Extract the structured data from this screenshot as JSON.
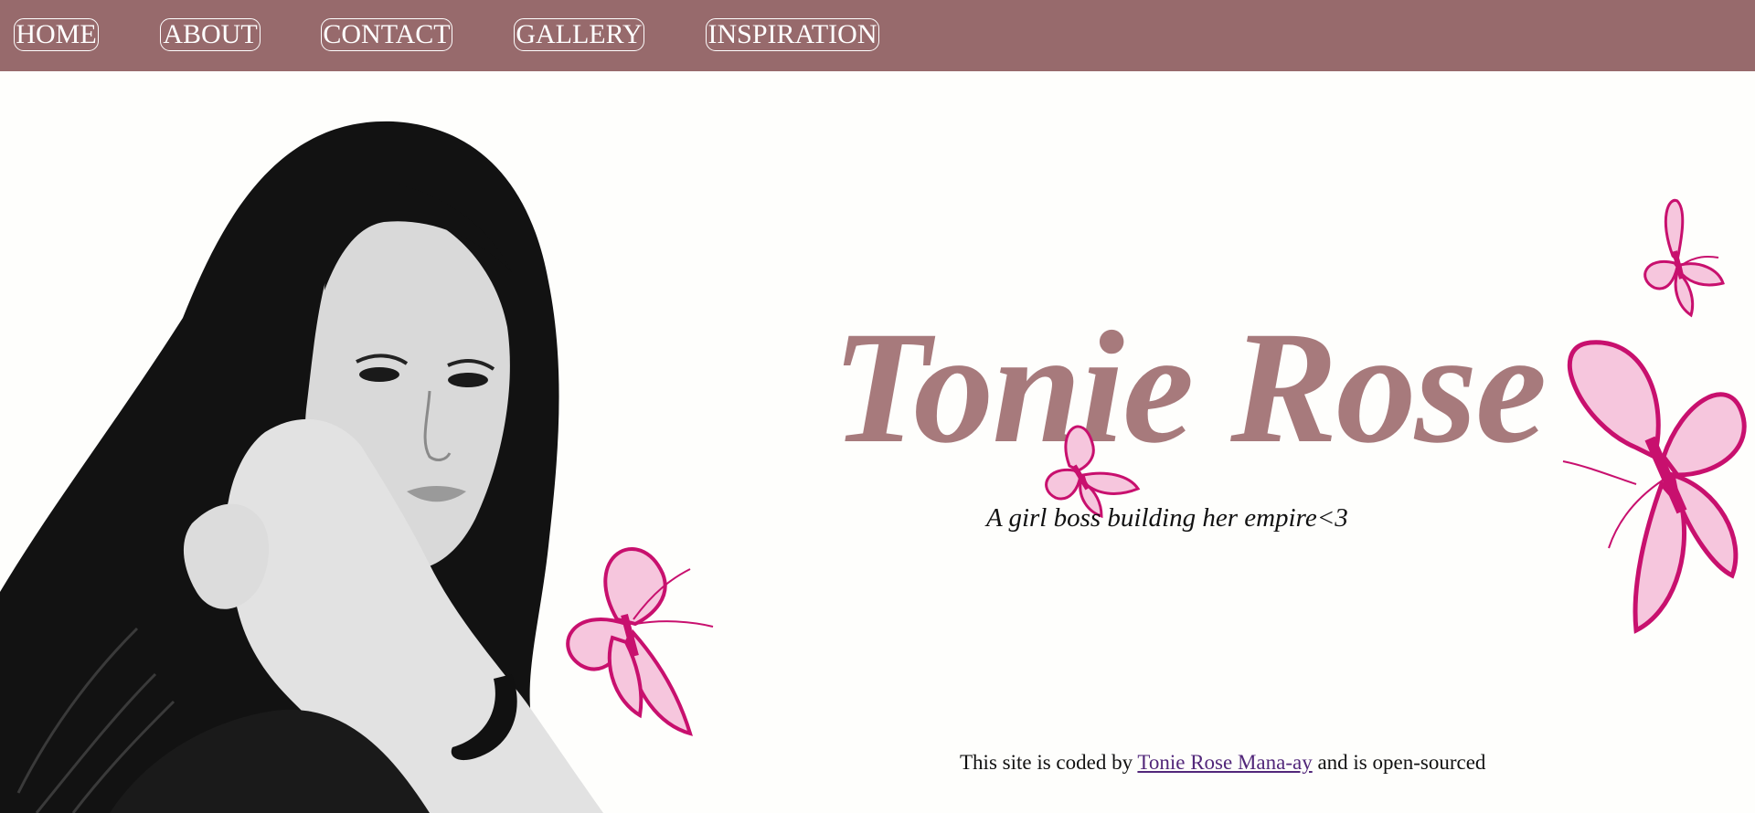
{
  "nav": {
    "items": [
      {
        "label": "HOME"
      },
      {
        "label": "ABOUT"
      },
      {
        "label": "CONTACT"
      },
      {
        "label": "GALLERY"
      },
      {
        "label": "INSPIRATION"
      }
    ]
  },
  "hero": {
    "title": "Tonie Rose",
    "tagline": "A girl boss building her empire<3"
  },
  "footer": {
    "prefix": "This site is coded by ",
    "author_link": "Tonie Rose Mana-ay",
    "suffix": " and is open-sourced"
  },
  "colors": {
    "nav_background": "#976a6c",
    "title": "#a77a7c",
    "butterfly": "#c8106e",
    "link": "#52277a"
  },
  "icons": {
    "portrait": "portrait-photo",
    "decor": "butterfly-icon"
  }
}
